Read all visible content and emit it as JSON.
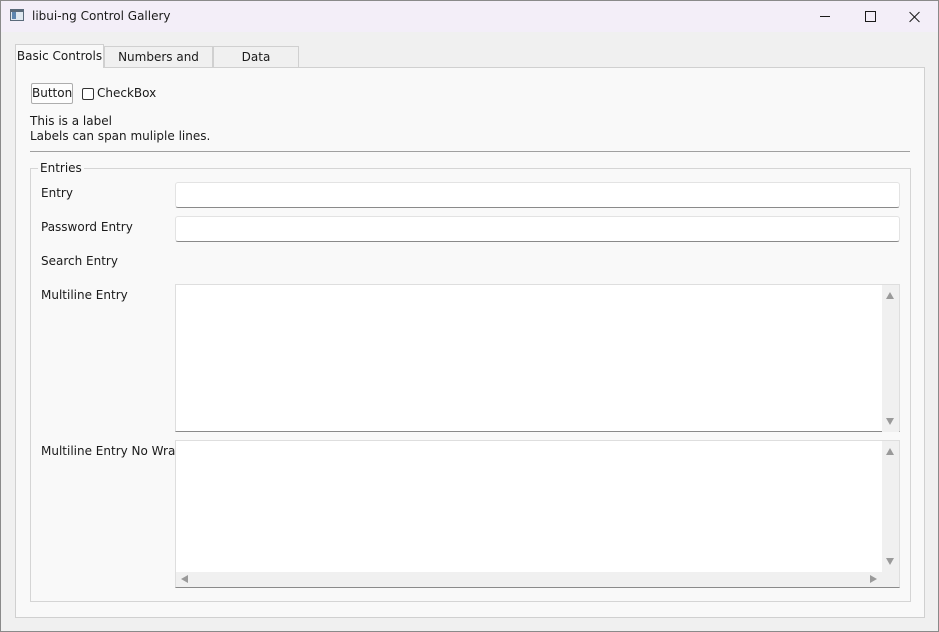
{
  "window": {
    "title": "libui-ng Control Gallery",
    "icon": "app-window-icon",
    "controls": {
      "minimize_icon": "minimize-icon",
      "maximize_icon": "maximize-icon",
      "close_icon": "close-icon"
    }
  },
  "tabs": [
    {
      "label": "Basic Controls",
      "active": true
    },
    {
      "label": "Numbers and Lists",
      "active": false
    },
    {
      "label": "Data Choosers",
      "active": false
    }
  ],
  "basic_controls": {
    "button_label": "Button",
    "checkbox_label": "CheckBox",
    "checkbox_checked": false,
    "label_line_1": "This is a label",
    "label_line_2": "Labels can span muliple lines.",
    "entries_group": {
      "title": "Entries",
      "fields": {
        "entry": {
          "label": "Entry",
          "value": ""
        },
        "password_entry": {
          "label": "Password Entry",
          "value": ""
        },
        "search_entry": {
          "label": "Search Entry",
          "value": ""
        },
        "multiline_entry": {
          "label": "Multiline Entry",
          "value": ""
        },
        "multiline_entry_no_wrap": {
          "label": "Multiline Entry No Wrap",
          "value": ""
        }
      }
    }
  },
  "colors": {
    "titlebar": "#f3eef8",
    "window_bg": "#f0f0f0",
    "pane_bg": "#f9f9f9",
    "field_bg": "#ffffff"
  }
}
